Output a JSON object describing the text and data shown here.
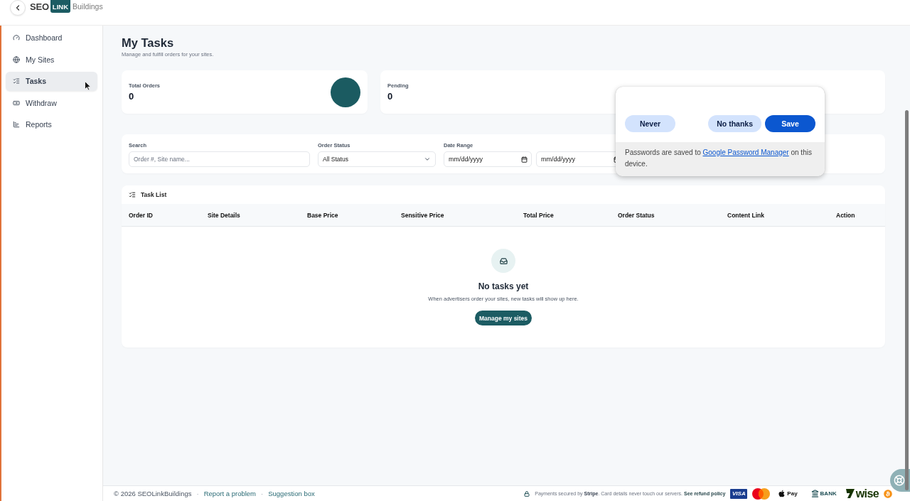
{
  "header": {
    "logo": {
      "prefix": "SEO",
      "badge": "LINK",
      "suffix": "Buildings"
    }
  },
  "sidebar": {
    "items": [
      {
        "label": "Dashboard",
        "selected": false
      },
      {
        "label": "My Sites",
        "selected": false
      },
      {
        "label": "Tasks",
        "selected": true
      },
      {
        "label": "Withdraw",
        "selected": false
      },
      {
        "label": "Reports",
        "selected": false
      }
    ]
  },
  "page": {
    "title": "My Tasks",
    "subtitle": "Manage and fulfill orders for your sites."
  },
  "stats": [
    {
      "label": "Total Orders",
      "value": "0",
      "has_icon": true
    },
    {
      "label": "Pending",
      "value": "0",
      "has_icon": false
    }
  ],
  "filters": {
    "search": {
      "label": "Search",
      "placeholder": "Order #, Site name..."
    },
    "status": {
      "label": "Order Status",
      "value": "All Status"
    },
    "date_range": {
      "label": "Date Range",
      "start": {
        "placeholder": "mm/dd/yyyy"
      },
      "end": {
        "placeholder": "mm/dd/yyyy"
      }
    }
  },
  "task_list": {
    "title": "Task List",
    "columns": [
      "Order ID",
      "Site Details",
      "Base Price",
      "Sensitive Price",
      "Total Price",
      "Order Status",
      "Content Link",
      "Action"
    ],
    "empty_state": {
      "title": "No tasks yet",
      "message": "When advertisers order your sites, new tasks will show up here.",
      "button": "Manage my sites"
    }
  },
  "password_prompt": {
    "buttons": [
      {
        "label": "Never",
        "kind": "tonal"
      },
      {
        "label": "No thanks",
        "kind": "tonal"
      },
      {
        "label": "Save",
        "kind": "filled"
      }
    ],
    "note": {
      "before": "Passwords are saved to",
      "link": "Google Password Manager",
      "after": "on this device."
    }
  },
  "footer": {
    "left": [
      {
        "kind": "text",
        "text": "© 2026 SEOLinkBuildings"
      },
      {
        "kind": "separator",
        "text": "·"
      },
      {
        "kind": "link",
        "text": "Report a problem"
      },
      {
        "kind": "separator",
        "text": "·"
      },
      {
        "kind": "link",
        "text": "Suggestion box"
      }
    ],
    "payment_note": "Payments secured by **Stripe**. Card details never touch our servers.",
    "refund_link": "See refund policy",
    "payment_methods": [
      {
        "kind": "visa",
        "label": "VISA"
      },
      {
        "kind": "mastercard"
      },
      {
        "kind": "apple-pay",
        "label": "Pay"
      },
      {
        "kind": "bank",
        "label": "BANK"
      },
      {
        "kind": "wise",
        "label": "wise"
      },
      {
        "kind": "bitcoin"
      }
    ]
  }
}
